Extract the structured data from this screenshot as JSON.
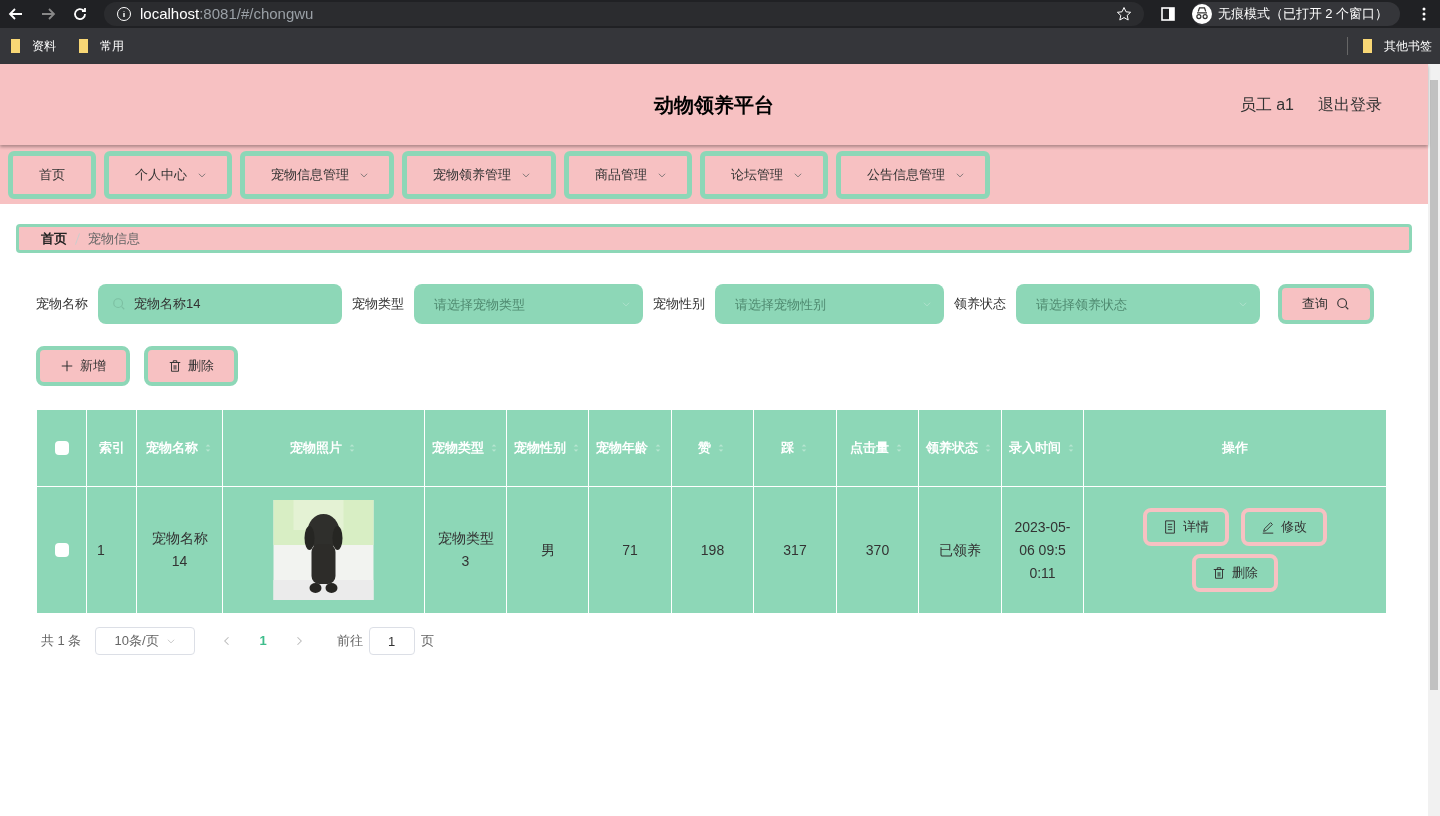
{
  "browser": {
    "url_host": "localhost",
    "url_rest": ":8081/#/chongwu",
    "incognito": "无痕模式（已打开 2 个窗口）",
    "bookmarks": [
      "资料",
      "常用"
    ],
    "other_bookmarks": "其他书签"
  },
  "header": {
    "title": "动物领养平台",
    "user": "员工 a1",
    "logout": "退出登录"
  },
  "nav": [
    {
      "label": "首页",
      "dropdown": false
    },
    {
      "label": "个人中心",
      "dropdown": true
    },
    {
      "label": "宠物信息管理",
      "dropdown": true
    },
    {
      "label": "宠物领养管理",
      "dropdown": true
    },
    {
      "label": "商品管理",
      "dropdown": true
    },
    {
      "label": "论坛管理",
      "dropdown": true
    },
    {
      "label": "公告信息管理",
      "dropdown": true
    }
  ],
  "breadcrumb": [
    "首页",
    "宠物信息"
  ],
  "filters": [
    {
      "label": "宠物名称",
      "kind": "input",
      "value": "宠物名称14"
    },
    {
      "label": "宠物类型",
      "kind": "select",
      "placeholder": "请选择宠物类型"
    },
    {
      "label": "宠物性别",
      "kind": "select",
      "placeholder": "请选择宠物性别"
    },
    {
      "label": "领养状态",
      "kind": "select",
      "placeholder": "请选择领养状态"
    }
  ],
  "search_button": "查询",
  "actions": [
    {
      "kind": "add",
      "label": "新增"
    },
    {
      "kind": "delete",
      "label": "删除"
    }
  ],
  "table": {
    "select_all_checked": false,
    "columns": [
      {
        "label": "索引",
        "sortable": false
      },
      {
        "label": "宠物名称",
        "sortable": true
      },
      {
        "label": "宠物照片",
        "sortable": true
      },
      {
        "label": "宠物类型",
        "sortable": true
      },
      {
        "label": "宠物性别",
        "sortable": true
      },
      {
        "label": "宠物年龄",
        "sortable": true
      },
      {
        "label": "赞",
        "sortable": true
      },
      {
        "label": "踩",
        "sortable": true
      },
      {
        "label": "点击量",
        "sortable": true
      },
      {
        "label": "领养状态",
        "sortable": true
      },
      {
        "label": "录入时间",
        "sortable": true
      },
      {
        "label": "操作",
        "sortable": false
      }
    ],
    "rows": [
      {
        "checked": false,
        "cells": [
          "1",
          "宠物名称14",
          {
            "kind": "picture"
          },
          "宠物类型3",
          "男",
          "71",
          "198",
          "317",
          "370",
          "已领养",
          "2023-05-06 09:50:11"
        ],
        "buttons": [
          {
            "kind": "detail",
            "label": "详情"
          },
          {
            "kind": "edit",
            "label": "修改"
          },
          {
            "kind": "delete",
            "label": "删除"
          }
        ]
      }
    ]
  },
  "pagination": {
    "total": "共 1 条",
    "page_size": "10条/页",
    "pages": [
      {
        "label": "1",
        "selected": true
      }
    ],
    "goto_label": "前往",
    "goto_value": "1",
    "goto_suffix": "页"
  }
}
